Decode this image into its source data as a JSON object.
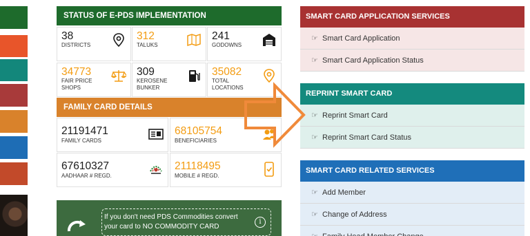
{
  "colors": {
    "green": "#1e6b2c",
    "orange": "#d9822b",
    "maroon": "#a52a2a",
    "teal": "#13877b",
    "blue": "#1e6db5",
    "accent_number": "#f39c12",
    "arrow": "#f08a3a"
  },
  "left_strips": [
    "#1e6b2c",
    "#e8552a",
    "#13877b",
    "#a83a3a",
    "#d9822b",
    "#1e6db5",
    "#c24a2a"
  ],
  "epds": {
    "title": "STATUS OF E-PDS IMPLEMENTATION",
    "tiles": [
      {
        "value": "38",
        "label": "DISTRICTS",
        "icon": "location-pin-icon",
        "style": "dark"
      },
      {
        "value": "312",
        "label": "TALUKS",
        "icon": "map-icon",
        "style": "orange"
      },
      {
        "value": "241",
        "label": "GODOWNS",
        "icon": "warehouse-icon",
        "style": "dark"
      },
      {
        "value": "34773",
        "label": "FAIR PRICE\nSHOPS",
        "icon": "scales-icon",
        "style": "orange"
      },
      {
        "value": "309",
        "label": "KEROSENE\nBUNKER",
        "icon": "fuel-pump-icon",
        "style": "dark"
      },
      {
        "value": "35082",
        "label": "TOTAL\nLOCATIONS",
        "icon": "location-pin-icon",
        "style": "orange"
      }
    ]
  },
  "family": {
    "title": "FAMILY CARD DETAILS",
    "tiles": [
      {
        "value": "21191471",
        "label": "FAMILY CARDS",
        "icon": "id-card-icon",
        "style": "dark"
      },
      {
        "value": "68105754",
        "label": "BENEFICIARIES",
        "icon": "users-icon",
        "style": "orange"
      },
      {
        "value": "67610327",
        "label": "AADHAAR # REGD.",
        "icon": "aadhaar-icon",
        "style": "dark"
      },
      {
        "value": "21118495",
        "label": "MOBILE # REGD.",
        "icon": "mobile-check-icon",
        "style": "orange"
      }
    ]
  },
  "banner": {
    "text": "If you don't need PDS Commodities convert your card to NO COMMODITY CARD",
    "info_symbol": "i"
  },
  "panels": [
    {
      "title": "SMART CARD APPLICATION SERVICES",
      "header_color": "#a83232",
      "bg": "#f6e6e6",
      "items": [
        "Smart Card Application",
        "Smart Card Application Status"
      ]
    },
    {
      "title": "REPRINT SMART CARD",
      "header_color": "#148a7e",
      "bg": "#dff0ec",
      "items": [
        "Reprint Smart Card",
        "Reprint Smart Card Status"
      ]
    },
    {
      "title": "SMART CARD RELATED SERVICES",
      "header_color": "#1f6fb8",
      "bg": "#e3edf7",
      "items": [
        "Add Member",
        "Change of Address",
        "Family Head Member Change"
      ]
    }
  ],
  "hand_symbol": "☞"
}
